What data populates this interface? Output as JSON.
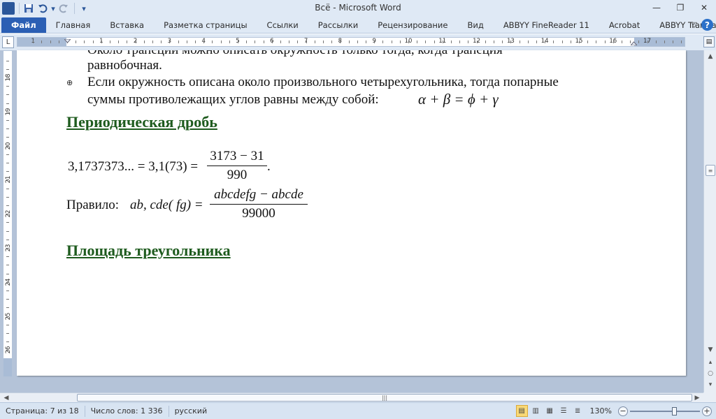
{
  "window": {
    "title": "Всё  -  Microsoft Word",
    "app_icon": "W",
    "controls": [
      "minimize-icon",
      "restore-icon",
      "close-icon"
    ]
  },
  "quick_access": [
    "save-icon",
    "undo-icon",
    "redo-icon",
    "customize-icon"
  ],
  "ribbon": {
    "file_tab": "Файл",
    "tabs": [
      "Главная",
      "Вставка",
      "Разметка страницы",
      "Ссылки",
      "Рассылки",
      "Рецензирование",
      "Вид",
      "ABBYY FineReader 11",
      "Acrobat",
      "ABBYY Translation"
    ]
  },
  "ruler": {
    "tab_selector": "L",
    "h_numbers": [
      "1",
      "2",
      "1",
      "2",
      "3",
      "4",
      "5",
      "6",
      "7",
      "8",
      "9",
      "10",
      "11",
      "12",
      "13",
      "14",
      "15",
      "16",
      "17"
    ],
    "v_numbers": [
      "18",
      "19",
      "20",
      "21",
      "22",
      "23",
      "24",
      "25",
      "26",
      "27"
    ]
  },
  "document": {
    "cut_line": "Около трапеции можно описать окружность только тогда, когда трапеция",
    "bullet1_line2": "равнобочная.",
    "bullet2_line1": "Если окружность описана около произвольного четырехугольника, тогда попарные",
    "bullet2_line2": "суммы противолежащих углов равны между собой:",
    "angle_formula": "α + β = ϕ + γ",
    "heading1": "Периодическая дробь",
    "periodic_lhs": "3,1737373... = 3,1(73) =",
    "periodic_num": "3173 − 31",
    "periodic_den": "990",
    "periodic_end": ".",
    "rule_label": "Правило:",
    "rule_lhs": "ab, cde( fg) =",
    "rule_num": "abcdefg − abcde",
    "rule_den": "99000",
    "heading2": "Площадь треугольника"
  },
  "statusbar": {
    "page": "Страница: 7 из 18",
    "words": "Число слов: 1 336",
    "language": "русский",
    "zoom": "130%"
  }
}
